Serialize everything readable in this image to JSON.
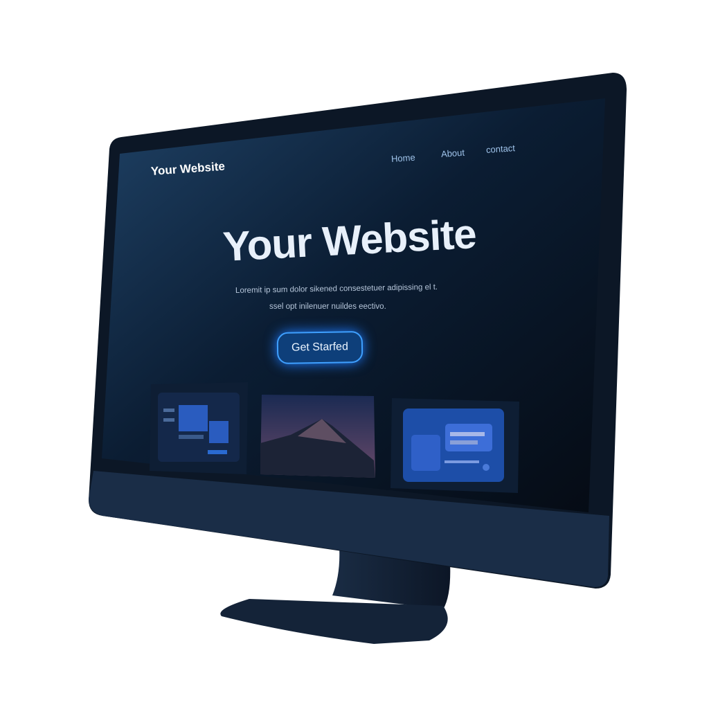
{
  "site": {
    "logo": "Your Website",
    "nav": [
      "Home",
      "About",
      "contact"
    ],
    "hero_title": "Your Website",
    "hero_lines": [
      "Loremit ip sum dolor sikened consestetuer adipissing el t.",
      "ssel opt inilenuer nuildes eectivo."
    ],
    "cta_label": "Get Starfed"
  },
  "colors": {
    "accent": "#3fa0ff",
    "screen": "#0a1a2e",
    "bezel": "#0b1524"
  }
}
